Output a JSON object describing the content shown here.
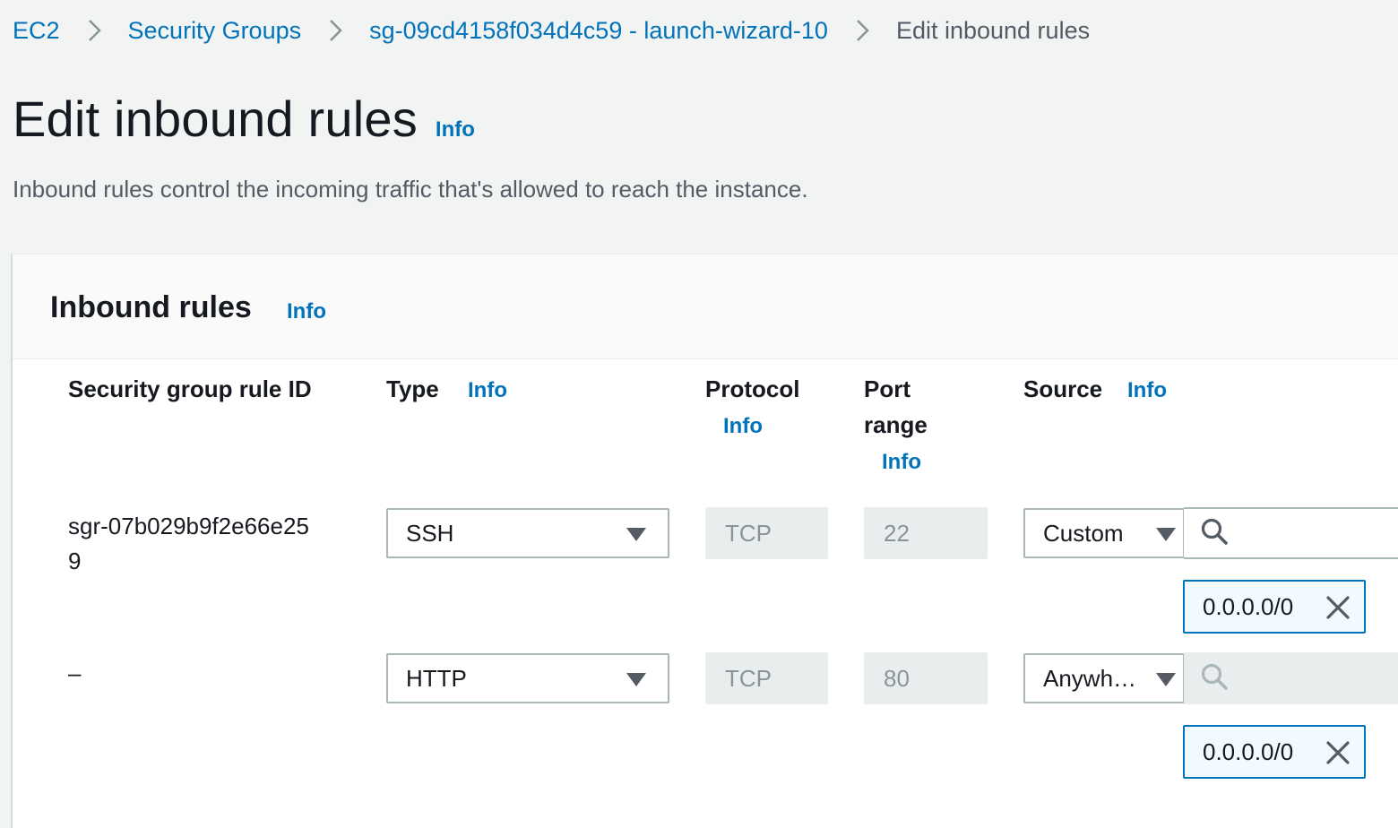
{
  "breadcrumb": {
    "items": [
      {
        "label": "EC2"
      },
      {
        "label": "Security Groups"
      },
      {
        "label": "sg-09cd4158f034d4c59 - launch-wizard-10"
      }
    ],
    "current": "Edit inbound rules"
  },
  "page": {
    "title": "Edit inbound rules",
    "info": "Info",
    "description": "Inbound rules control the incoming traffic that's allowed to reach the instance."
  },
  "panel": {
    "title": "Inbound rules",
    "info": "Info"
  },
  "columns": {
    "rule_id": "Security group rule ID",
    "type": "Type",
    "type_info": "Info",
    "protocol": "Protocol",
    "protocol_info": "Info",
    "port_line1": "Port",
    "port_line2": "range",
    "port_info": "Info",
    "source": "Source",
    "source_info": "Info"
  },
  "rules": [
    {
      "rule_id_line1": "sgr-07b029b9f2e66e25",
      "rule_id_line2": "9",
      "type": "SSH",
      "protocol": "TCP",
      "port": "22",
      "source": "Custom",
      "cidr": "0.0.0.0/0"
    },
    {
      "rule_id_line1": "–",
      "rule_id_line2": "",
      "type": "HTTP",
      "protocol": "TCP",
      "port": "80",
      "source": "Anywh…",
      "cidr": "0.0.0.0/0"
    }
  ],
  "icons": {
    "chevron": "chevron-right-icon",
    "caret": "caret-down-icon",
    "search": "search-icon",
    "remove": "close-icon"
  },
  "colors": {
    "link": "#0073bb",
    "background": "#f2f3f3",
    "token_border": "#0073bb",
    "token_background": "#f1faff",
    "readonly": "#eaeded"
  }
}
